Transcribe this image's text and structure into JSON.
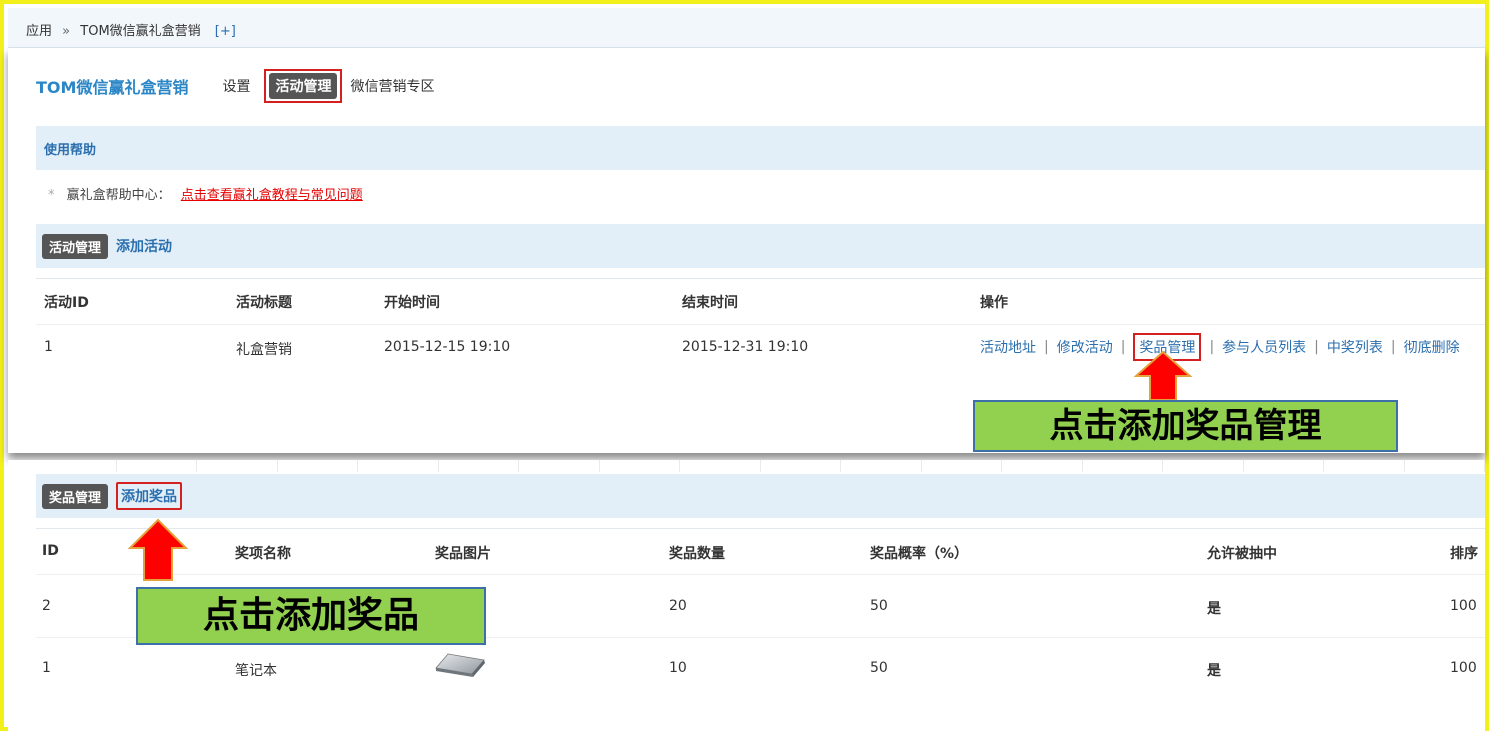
{
  "breadcrumb": {
    "root": "应用",
    "sep": "»",
    "current": "TOM微信赢礼盒营销",
    "add": "[+]"
  },
  "appnav": {
    "brand": "TOM微信赢礼盒营销",
    "items": [
      {
        "label": "设置",
        "active": false
      },
      {
        "label": "活动管理",
        "active": true
      },
      {
        "label": "微信营销专区",
        "active": false
      }
    ]
  },
  "help": {
    "title": "使用帮助",
    "bullet": "*",
    "text": "赢礼盒帮助中心：",
    "link": "点击查看赢礼盒教程与常见问题"
  },
  "activities": {
    "tag": "活动管理",
    "add_link": "添加活动",
    "columns": [
      "活动ID",
      "活动标题",
      "开始时间",
      "结束时间",
      "操作"
    ],
    "rows": [
      {
        "id": "1",
        "title": "礼盒营销",
        "start": "2015-12-15 19:10",
        "end": "2015-12-31 19:10"
      }
    ],
    "ops": [
      "活动地址",
      "修改活动",
      "奖品管理",
      "参与人员列表",
      "中奖列表",
      "彻底删除"
    ],
    "ops_sep": "|"
  },
  "prizes": {
    "tag": "奖品管理",
    "add_link": "添加奖品",
    "columns": [
      "ID",
      "奖项名称",
      "奖品图片",
      "奖品数量",
      "奖品概率（%）",
      "允许被抽中",
      "排序"
    ],
    "rows": [
      {
        "id": "2",
        "name": "",
        "qty": "20",
        "prob": "50",
        "allowed": "是",
        "sort": "100"
      },
      {
        "id": "1",
        "name": "笔记本",
        "qty": "10",
        "prob": "50",
        "allowed": "是",
        "sort": "100"
      }
    ]
  },
  "annotations": {
    "prize_manage": "点击添加奖品管理",
    "add_prize": "点击添加奖品"
  },
  "colors": {
    "accent": "#2b6fae",
    "highlight_border": "#d42020",
    "callout_bg": "#92d050",
    "frame": "#f2ef1a",
    "arrow": "#ff0000"
  }
}
